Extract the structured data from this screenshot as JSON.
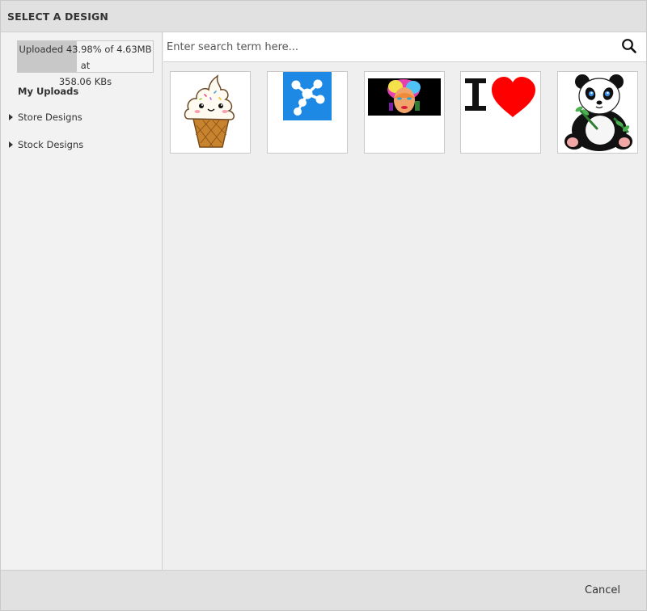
{
  "dialog": {
    "title": "SELECT A DESIGN"
  },
  "sidebar": {
    "upload_progress": {
      "line1": "Uploaded 43.98% of 4.63MB at",
      "line2": "358.06 KBs",
      "percent": 43.98
    },
    "heading": "My Uploads",
    "items": [
      {
        "label": "Store Designs",
        "icon": "caret-right-icon"
      },
      {
        "label": "Stock Designs",
        "icon": "caret-right-icon"
      }
    ]
  },
  "search": {
    "placeholder": "Enter search term here...",
    "value": "",
    "icon": "search-icon"
  },
  "designs": [
    {
      "name": "ice-cream-cone-design"
    },
    {
      "name": "blue-molecule-logo-design"
    },
    {
      "name": "pop-art-portrait-design"
    },
    {
      "name": "i-heart-design"
    },
    {
      "name": "panda-design"
    }
  ],
  "footer": {
    "cancel_label": "Cancel"
  },
  "colors": {
    "logo_blue": "#1e88e5",
    "heart_red": "#ff0000"
  }
}
